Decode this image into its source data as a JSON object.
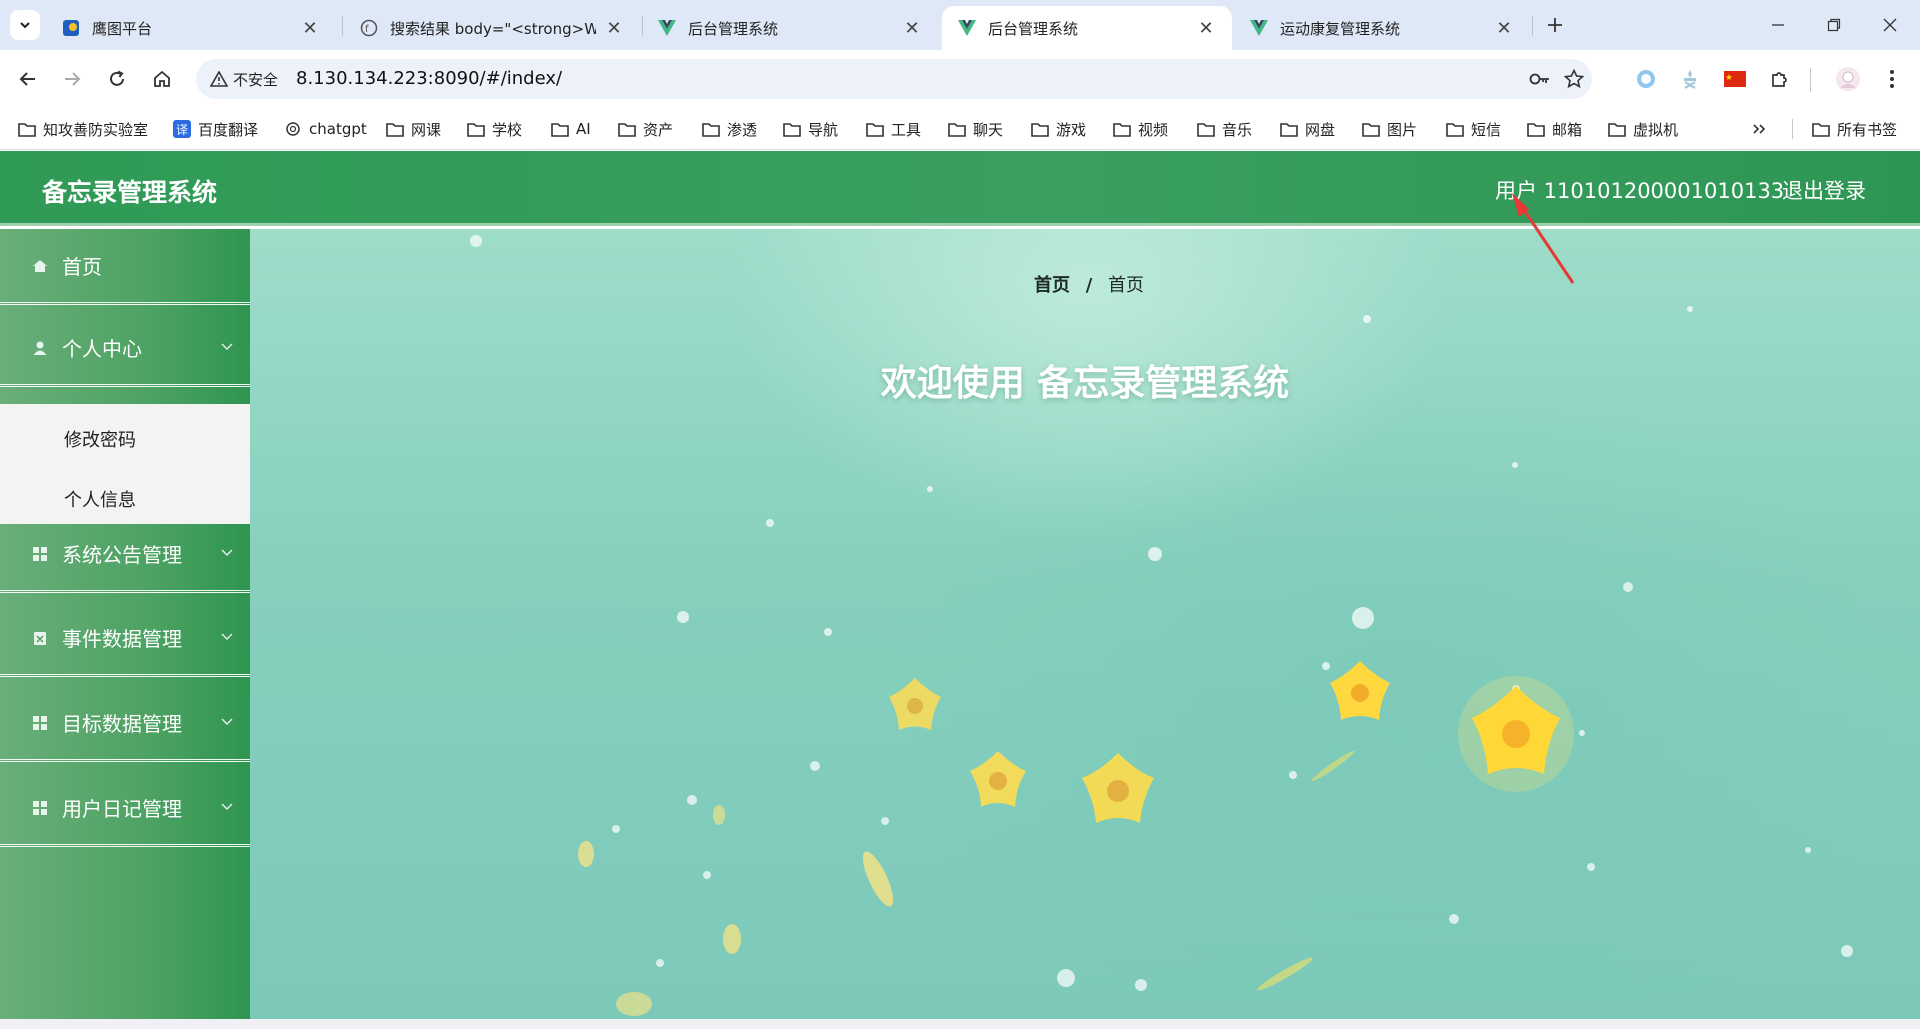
{
  "browser": {
    "tabs": [
      {
        "title": "鹰图平台",
        "icon": "hawk-favicon"
      },
      {
        "title": "搜索结果 body=\"<strong>We",
        "icon": "search-favicon"
      },
      {
        "title": "后台管理系统",
        "icon": "vue-favicon"
      },
      {
        "title": "后台管理系统",
        "icon": "vue-favicon",
        "active": true
      },
      {
        "title": "运动康复管理系统",
        "icon": "vue-favicon"
      }
    ],
    "security_label": "不安全",
    "url": "8.130.134.223:8090/#/index/",
    "bookmarks": [
      {
        "label": "知攻善防实验室",
        "icon": "folder-icon"
      },
      {
        "label": "百度翻译",
        "icon": "translate-icon"
      },
      {
        "label": "chatgpt",
        "icon": "openai-icon"
      },
      {
        "label": "网课",
        "icon": "folder-icon"
      },
      {
        "label": "学校",
        "icon": "folder-icon"
      },
      {
        "label": "AI",
        "icon": "folder-icon"
      },
      {
        "label": "资产",
        "icon": "folder-icon"
      },
      {
        "label": "渗透",
        "icon": "folder-icon"
      },
      {
        "label": "导航",
        "icon": "folder-icon"
      },
      {
        "label": "工具",
        "icon": "folder-icon"
      },
      {
        "label": "聊天",
        "icon": "folder-icon"
      },
      {
        "label": "游戏",
        "icon": "folder-icon"
      },
      {
        "label": "视频",
        "icon": "folder-icon"
      },
      {
        "label": "音乐",
        "icon": "folder-icon"
      },
      {
        "label": "网盘",
        "icon": "folder-icon"
      },
      {
        "label": "图片",
        "icon": "folder-icon"
      },
      {
        "label": "短信",
        "icon": "folder-icon"
      },
      {
        "label": "邮箱",
        "icon": "folder-icon"
      },
      {
        "label": "虚拟机",
        "icon": "folder-icon"
      }
    ],
    "all_bookmarks": "所有书签"
  },
  "app": {
    "title": "备忘录管理系统",
    "user_label": "用户 110101200001010133",
    "logout": "退出登录",
    "menu": {
      "home": "首页",
      "personal": "个人中心",
      "change_password": "修改密码",
      "personal_info": "个人信息",
      "notice": "系统公告管理",
      "events": "事件数据管理",
      "targets": "目标数据管理",
      "diary": "用户日记管理"
    },
    "breadcrumb": {
      "first": "首页",
      "separator": "/",
      "current": "首页"
    },
    "welcome": "欢迎使用 备忘录管理系统"
  },
  "colors": {
    "header_green": "#2f9a56",
    "sidebar_green": "#4da263",
    "annotation_red": "#e53935"
  }
}
